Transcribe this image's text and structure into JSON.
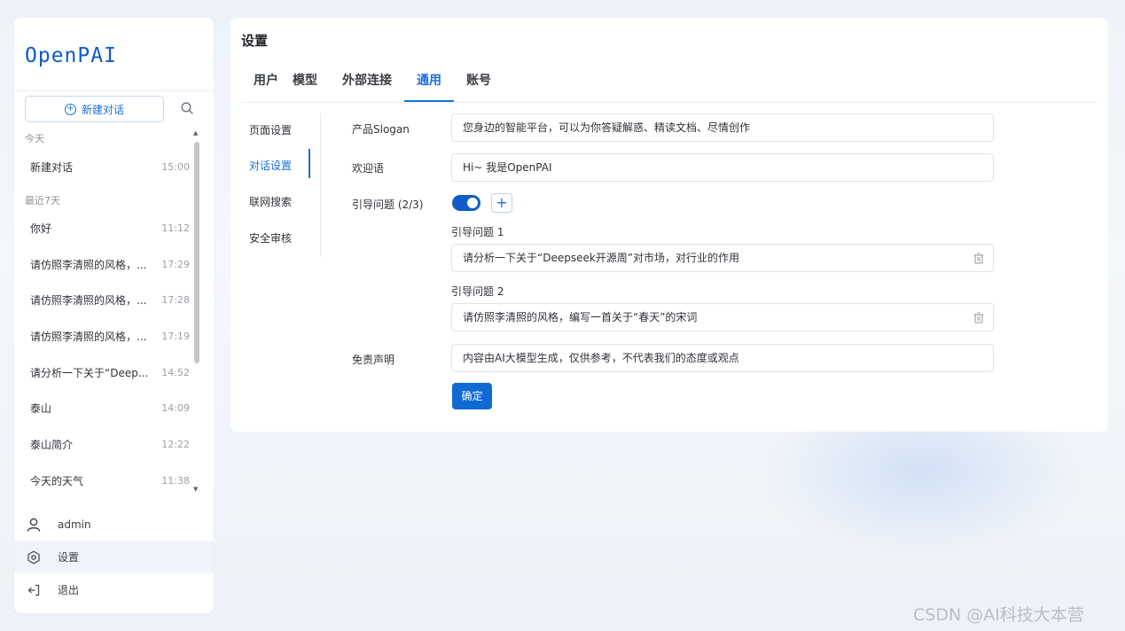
{
  "sidebar": {
    "logo": "OpenPAI",
    "new_chat_label": "新建对话",
    "groups": [
      {
        "label": "今天",
        "items": [
          {
            "title": "新建对话",
            "time": "15:00"
          }
        ]
      },
      {
        "label": "最近7天",
        "items": [
          {
            "title": "你好",
            "time": "11:12"
          },
          {
            "title": "请仿照李清照的风格，...",
            "time": "17:29"
          },
          {
            "title": "请仿照李清照的风格，...",
            "time": "17:28"
          },
          {
            "title": "请仿照李清照的风格，...",
            "time": "17:19"
          },
          {
            "title": "请分析一下关于“Deep...",
            "time": "14:52"
          },
          {
            "title": "泰山",
            "time": "14:09"
          },
          {
            "title": "泰山简介",
            "time": "12:22"
          },
          {
            "title": "今天的天气",
            "time": "11:38"
          }
        ]
      }
    ],
    "menu": [
      {
        "label": "admin",
        "icon": "user-icon"
      },
      {
        "label": "设置",
        "icon": "settings-icon"
      },
      {
        "label": "退出",
        "icon": "logout-icon"
      }
    ]
  },
  "main": {
    "title": "设置",
    "tabs": [
      "用户",
      "模型",
      "外部连接",
      "通用",
      "账号"
    ],
    "active_tab": "通用",
    "subnav": [
      "页面设置",
      "对话设置",
      "联网搜索",
      "安全审核"
    ],
    "active_subnav": "对话设置",
    "form": {
      "slogan_label": "产品Slogan",
      "slogan_value": "您身边的智能平台，可以为你答疑解惑、精读文档、尽情创作",
      "welcome_label": "欢迎语",
      "welcome_value": "Hi~ 我是OpenPAI",
      "guide_label": "引导问题 (2/3)",
      "guide_enabled": true,
      "guides": [
        {
          "label": "引导问题 1",
          "value": "请分析一下关于“Deepseek开源周”对市场，对行业的作用"
        },
        {
          "label": "引导问题 2",
          "value": "请仿照李清照的风格，编写一首关于“春天”的宋词"
        }
      ],
      "disclaimer_label": "免责声明",
      "disclaimer_value": "内容由AI大模型生成，仅供参考，不代表我们的态度或观点",
      "confirm_label": "确定"
    }
  },
  "watermark": "CSDN @AI科技大本营",
  "colors": {
    "accent": "#1a6ed8",
    "primary_button": "#0f6ad4",
    "background": "#eef3f9"
  }
}
